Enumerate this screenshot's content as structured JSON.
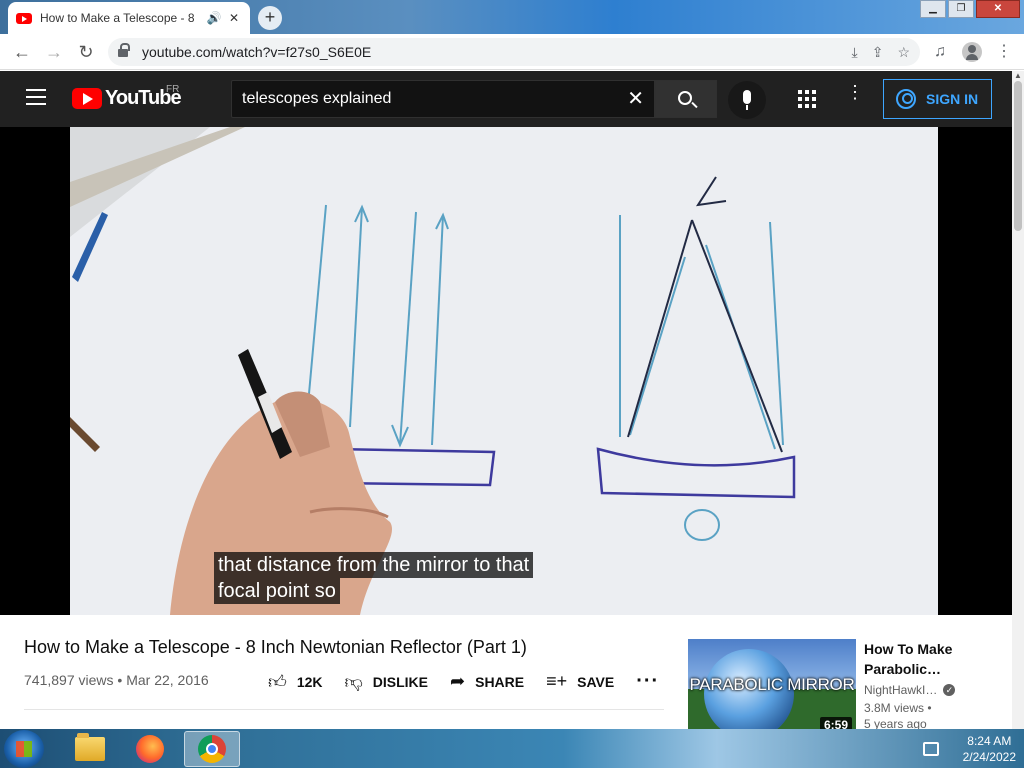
{
  "browser": {
    "tab_title": "How to Make a Telescope - 8",
    "url": "youtube.com/watch?v=f27s0_S6E0E"
  },
  "youtube": {
    "logo_text": "YouTube",
    "region": "FR",
    "search_value": "telescopes explained",
    "sign_in": "SIGN IN"
  },
  "video": {
    "subtitle_line1": "that distance from the mirror to that",
    "subtitle_line2": "focal point so",
    "title": "How to Make a Telescope - 8 Inch Newtonian Reflector (Part 1)",
    "views": "741,897 views",
    "date": "Mar 22, 2016",
    "likes": "12K",
    "dislike": "DISLIKE",
    "share": "SHARE",
    "save": "SAVE"
  },
  "recommendation": {
    "thumb_label": "PARABOLIC MIRROR",
    "duration": "6:59",
    "title": "How To Make Parabolic…",
    "channel": "NightHawkI…",
    "views": "3.8M views •",
    "age": "5 years ago"
  },
  "taskbar": {
    "time": "8:24 AM",
    "date": "2/24/2022"
  },
  "icons": [
    "speaker-icon",
    "close-icon",
    "lock-icon",
    "download-icon",
    "share-icon",
    "star-icon",
    "media-icon",
    "profile-icon",
    "menu-icon",
    "search-icon",
    "mic-icon",
    "apps-icon",
    "more-icon",
    "like-icon",
    "dislike-icon",
    "share-arrow-icon",
    "save-icon",
    "verified-icon"
  ]
}
